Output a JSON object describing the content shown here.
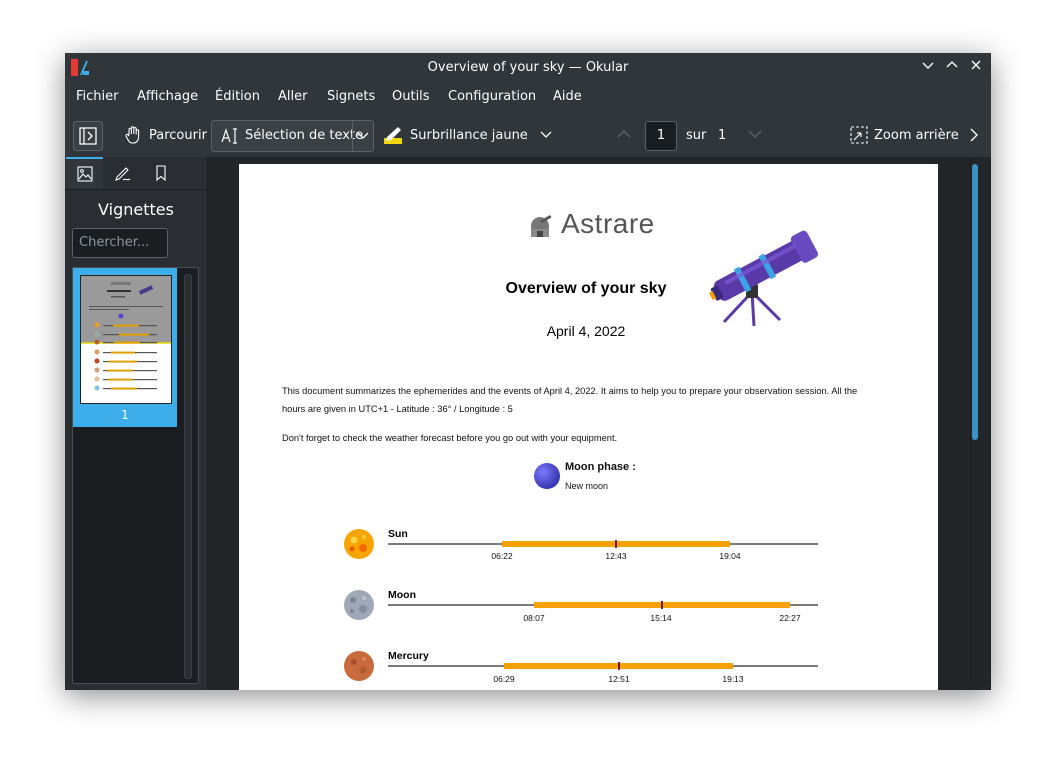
{
  "window": {
    "title": "Overview of your sky — Okular"
  },
  "menu": [
    "Fichier",
    "Affichage",
    "Édition",
    "Aller",
    "Signets",
    "Outils",
    "Configuration",
    "Aide"
  ],
  "toolbar": {
    "browse": "Parcourir",
    "text_selection": "Sélection de texte",
    "highlight": "Surbrillance jaune",
    "page_current": "1",
    "page_of": "sur",
    "page_total": "1",
    "zoom_out": "Zoom arrière"
  },
  "sidebar": {
    "title": "Vignettes",
    "search_placeholder": "Chercher...",
    "thumbnail_number": "1"
  },
  "document": {
    "brand": "Astrare",
    "title": "Overview of your sky",
    "date": "April 4, 2022",
    "intro_line1": "This document summarizes the ephemerides and the events of April 4, 2022. It aims to help you to prepare your observation session. All the",
    "intro_line2": "hours are given in UTC+1 - Latitude : 36° / Longitude : 5",
    "weather_note": "Don't forget to check the weather forecast before you go out with your equipment.",
    "moon_phase_label": "Moon phase :",
    "moon_phase_value": "New moon",
    "bodies": [
      {
        "name": "Sun",
        "rise": "06:22",
        "culmination": "12:43",
        "set": "19:04"
      },
      {
        "name": "Moon",
        "rise": "08:07",
        "culmination": "15:14",
        "set": "22:27"
      },
      {
        "name": "Mercury",
        "rise": "06:29",
        "culmination": "12:51",
        "set": "19:13"
      }
    ]
  },
  "colors": {
    "accent": "#3daee9",
    "timeline_bar": "#f5a201",
    "window_bg": "#2a2e32"
  }
}
